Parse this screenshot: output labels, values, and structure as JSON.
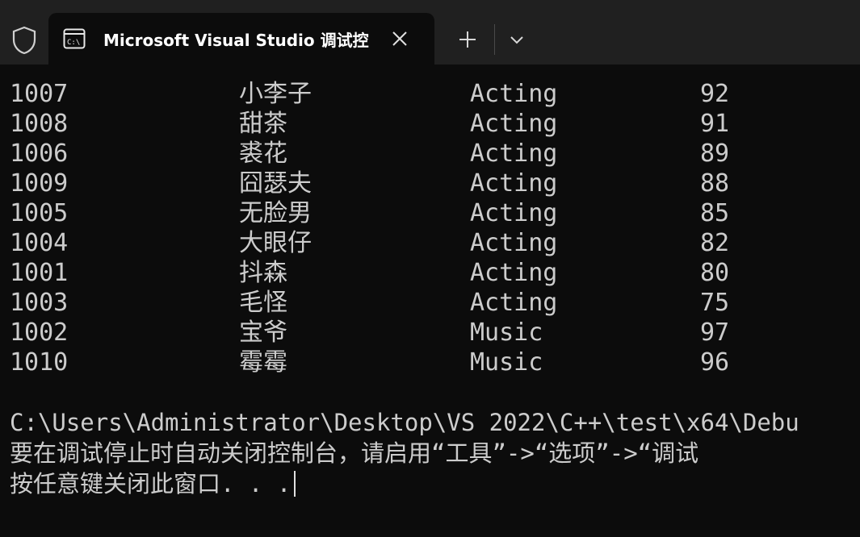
{
  "window": {
    "tab_title": "Microsoft Visual Studio 调试控",
    "tab_icon": "console-icon",
    "close_icon": "close-icon",
    "new_tab_icon": "plus-icon",
    "dropdown_icon": "chevron-down-icon",
    "shield_icon": "shield-icon"
  },
  "rows": [
    {
      "id": "1007",
      "name": "小李子",
      "dept": "Acting",
      "score": "92"
    },
    {
      "id": "1008",
      "name": "甜茶",
      "dept": "Acting",
      "score": "91"
    },
    {
      "id": "1006",
      "name": "裘花",
      "dept": "Acting",
      "score": "89"
    },
    {
      "id": "1009",
      "name": "囧瑟夫",
      "dept": "Acting",
      "score": "88"
    },
    {
      "id": "1005",
      "name": "无脸男",
      "dept": "Acting",
      "score": "85"
    },
    {
      "id": "1004",
      "name": "大眼仔",
      "dept": "Acting",
      "score": "82"
    },
    {
      "id": "1001",
      "name": "抖森",
      "dept": "Acting",
      "score": "80"
    },
    {
      "id": "1003",
      "name": "毛怪",
      "dept": "Acting",
      "score": "75"
    },
    {
      "id": "1002",
      "name": "宝爷",
      "dept": "Music",
      "score": "97"
    },
    {
      "id": "1010",
      "name": "霉霉",
      "dept": "Music",
      "score": "96"
    }
  ],
  "footer": {
    "path_line": "C:\\Users\\Administrator\\Desktop\\VS 2022\\C++\\test\\x64\\Debu",
    "hint_line": "要在调试停止时自动关闭控制台，请启用“工具”->“选项”->“调试",
    "prompt_line": "按任意键关闭此窗口. . ."
  }
}
